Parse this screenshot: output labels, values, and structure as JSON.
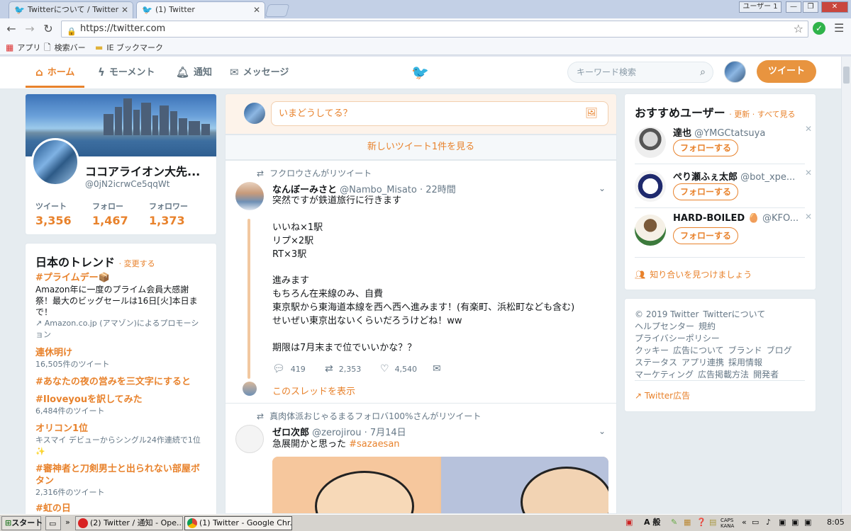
{
  "browser": {
    "tabs": [
      {
        "title": "Twitterについて / Twitter"
      },
      {
        "title": "(1) Twitter"
      }
    ],
    "user_button": "ユーザー 1",
    "url": "https://twitter.com",
    "bookmarks": [
      {
        "label": "アプリ",
        "icon": "apps-icon"
      },
      {
        "label": "検索バー",
        "icon": "page-icon"
      },
      {
        "label": "IE ブックマーク",
        "icon": "folder-icon"
      }
    ]
  },
  "twitter_nav": {
    "items": [
      {
        "label": "ホーム",
        "icon": "home-icon"
      },
      {
        "label": "モーメント",
        "icon": "bolt-icon"
      },
      {
        "label": "通知",
        "icon": "bell-icon"
      },
      {
        "label": "メッセージ",
        "icon": "envelope-icon"
      }
    ],
    "search_placeholder": "キーワード検索",
    "tweet_button": "ツイート"
  },
  "profile": {
    "name": "ココアライオン大先...",
    "handle": "@0jN2icrwCe5qqWt",
    "stats": [
      {
        "label": "ツイート",
        "value": "3,356"
      },
      {
        "label": "フォロー",
        "value": "1,467"
      },
      {
        "label": "フォロワー",
        "value": "1,373"
      }
    ]
  },
  "trends": {
    "title": "日本のトレンド",
    "change_label": "· 変更する",
    "items": [
      {
        "name": "#プライムデー📦",
        "desc": "Amazon年に一度のプライム会員大感謝祭！最大のビッグセールは16日[火]本日まで！",
        "meta": "Amazon.co.jp (アマゾン)によるプロモーション"
      },
      {
        "name": "連休明け",
        "desc": "",
        "meta": "16,505件のツイート"
      },
      {
        "name": "#あなたの夜の営みを三文字にすると",
        "desc": "",
        "meta": ""
      },
      {
        "name": "#Iloveyouを訳してみた",
        "desc": "",
        "meta": "6,484件のツイート"
      },
      {
        "name": "オリコン1位",
        "desc": "キスマイ デビューからシングル24作連続で1位✨",
        "meta": ""
      },
      {
        "name": "#審神者と刀剣男士と出られない部屋ボタン",
        "desc": "",
        "meta": "2,316件のツイート"
      },
      {
        "name": "#虹の日",
        "desc": "",
        "meta": ""
      }
    ]
  },
  "composer": {
    "placeholder": "いまどうしてる？",
    "new_tweets": "新しいツイート1件を見る"
  },
  "tweets": [
    {
      "retweeted_by": "フクロウさんがリツイート",
      "name": "なんぼーみさと",
      "handle": "@Nambo_Misato",
      "time": "· 22時間",
      "text": "突然ですが鉄道旅行に行きます\n\nいいね×1駅\nリプ×2駅\nRT×3駅\n\n進みます\nもちろん在来線のみ、自費\n東京駅から東海道本線を西へ西へ進みます！(有楽町、浜松町なども含む)\nせいぜい東京出ないくらいだろうけどね！ww\n\n期限は7月末まで位でいいかな？？",
      "replies": "419",
      "retweets": "2,353",
      "likes": "4,540",
      "show_thread": "このスレッドを表示"
    },
    {
      "retweeted_by": "真肉体派おじゃるまるフォロバ100%さんがリツイート",
      "name": "ゼロ次郎",
      "handle": "@zerojirou",
      "time": "· 7月14日",
      "text": "急展開かと思った ",
      "hashtag": "#sazaesan"
    }
  ],
  "recommended": {
    "title": "おすすめユーザー",
    "links": "· 更新 · すべて見る",
    "users": [
      {
        "name": "達也",
        "handle": "@YMGCtatsuya",
        "follow": "フォローする"
      },
      {
        "name": "ぺり瀬ふぇ太郎",
        "handle": "@bot_xpe...",
        "follow": "フォローする"
      },
      {
        "name": "HARD-BOILED 🥚",
        "handle": "@KFO...",
        "follow": "フォローする"
      }
    ],
    "find_friends": "知り合いを見つけましょう"
  },
  "footer": {
    "links": [
      "© 2019 Twitter",
      "Twitterについて",
      "ヘルプセンター",
      "規約",
      "プライバシーポリシー",
      "クッキー",
      "広告について",
      "ブランド",
      "ブログ",
      "ステータス",
      "アプリ連携",
      "採用情報",
      "マーケティング",
      "広告掲載方法",
      "開発者"
    ],
    "ads": "Twitter広告"
  },
  "taskbar": {
    "start": "スタート",
    "apps": [
      {
        "label": "(2) Twitter / 通知 - Ope..."
      },
      {
        "label": "(1) Twitter - Google Chr..."
      }
    ],
    "ime": "A 般",
    "caps": "CAPS KANA",
    "clock": "8:05"
  },
  "colors": {
    "accent": "#e8822c",
    "twitter_blue": "#1da1f2"
  }
}
